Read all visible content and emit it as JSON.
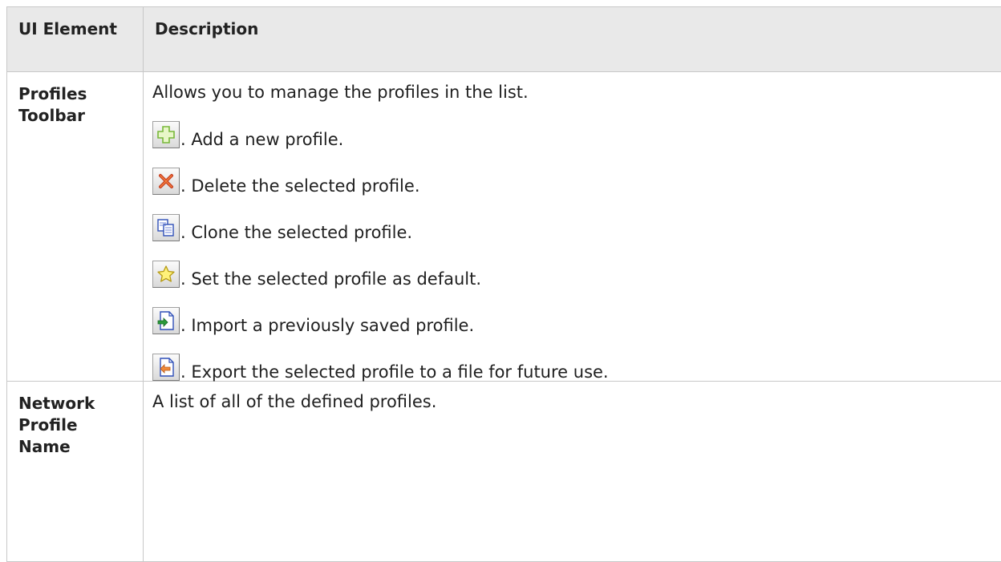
{
  "table": {
    "headers": {
      "ui_element": "UI Element",
      "description": "Description"
    },
    "rows": [
      {
        "term": "Profiles Toolbar",
        "intro": "Allows you to manage the profiles in the list.",
        "tools": [
          {
            "icon": "add-profile-icon",
            "text": ". Add a new profile."
          },
          {
            "icon": "delete-profile-icon",
            "text": ". Delete the selected profile."
          },
          {
            "icon": "clone-profile-icon",
            "text": ". Clone the selected profile."
          },
          {
            "icon": "set-default-star-icon",
            "text": ". Set the selected profile as default."
          },
          {
            "icon": "import-profile-icon",
            "text": ". Import a previously saved profile."
          },
          {
            "icon": "export-profile-icon",
            "text": ". Export the selected profile to a file for future use."
          }
        ]
      },
      {
        "term": "Network Profile Name",
        "intro": "A list of all of the defined profiles."
      }
    ]
  },
  "colors": {
    "header_bg": "#e9e9e9",
    "border": "#c8c8c8"
  }
}
